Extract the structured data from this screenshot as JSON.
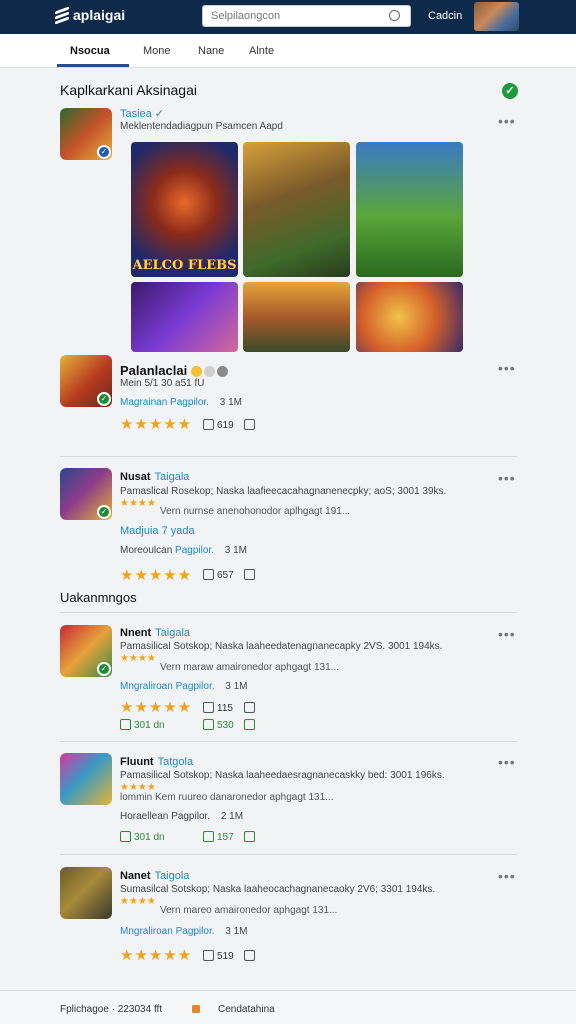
{
  "header": {
    "logo_text": "aplaigai",
    "search_placeholder": "Selpilaongcon",
    "right_link": "Cadcin"
  },
  "tabs": [
    {
      "label": "Nsocua",
      "active": true
    },
    {
      "label": "Mone",
      "active": false
    },
    {
      "label": "Nane",
      "active": false
    },
    {
      "label": "Alnte",
      "active": false
    }
  ],
  "featured": {
    "section_title": "Kaplkarkani Aksinagai",
    "app_name": "Tasiea",
    "app_desc": "Meklentendadiagpun Psamcen Aapd",
    "banner_text": "AELCO FLEBS"
  },
  "items": [
    {
      "name": "Palanlaclai",
      "line1": "Mein 5/1 30 a51 fU",
      "link": "Magrainan Pagpilor.",
      "size": "3 1M",
      "count": "619"
    },
    {
      "name": "Nusat",
      "tag": "Taigala",
      "desc": "Pamaslical Rosekop; Naska laafieecacahagnanenecpky; aoS; 3001 39ks.",
      "sub_link": "Madjuia 7 yada",
      "meta_a": "Moreoulcan",
      "meta_b": "Pagpilor.",
      "size": "3 1M",
      "count": "657"
    }
  ],
  "section2_title": "Uakanmngos",
  "items2": [
    {
      "name": "Nnent",
      "tag": "Taigala",
      "desc": "Pamasilical Sotskop; Naska laaheedatenagnanecapky 2VS. 3001 194ks.",
      "desc2": "Vern maraw amaironedor aphgagt 131...",
      "link": "Mngraliroan Pagpilor.",
      "size": "3 1M",
      "count_a": "115",
      "green_a": "301 dn",
      "green_b": "530"
    },
    {
      "name": "Fluunt",
      "tag": "Tatgola",
      "desc": "Pamasilical Sotskop; Naska laaheedaesragnanecaskky bed: 3001 196ks.",
      "desc2": "lommin Kem ruureo danaronedor aphgagt 131...",
      "meta_a": "Horaellean Pagpilor.",
      "size": "2 1M",
      "green_a": "301 dn",
      "green_b": "157"
    },
    {
      "name": "Nanet",
      "tag": "Taigola",
      "desc": "Sumasilcal Sotskop; Naska laaheocachagnanecaoky 2V6; 3301 194ks.",
      "desc2": "Vern mareo amaironedor aphgagt 131...",
      "link": "Mngraliroan Pagpilor.",
      "size": "3 1M",
      "count": "519"
    }
  ],
  "footer": {
    "left": "Fplichagoe  · 223034 fft",
    "right": "Cendatahina"
  }
}
